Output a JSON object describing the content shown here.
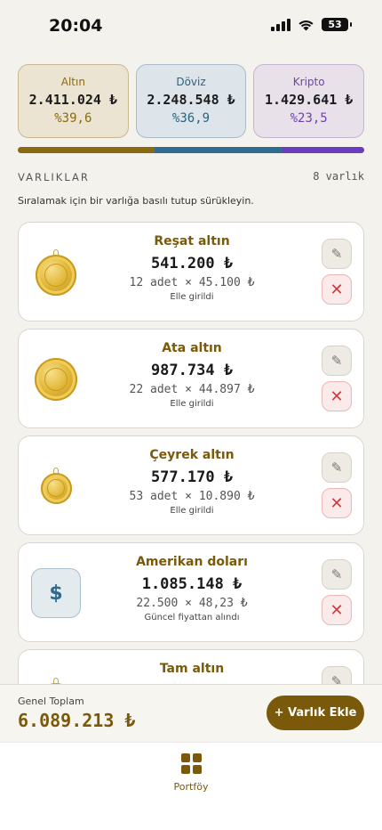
{
  "status": {
    "time": "20:04",
    "battery": "53"
  },
  "summary": [
    {
      "label": "Altın",
      "amount": "2.411.024 ₺",
      "percent": "%39,6"
    },
    {
      "label": "Döviz",
      "amount": "2.248.548 ₺",
      "percent": "%36,9"
    },
    {
      "label": "Kripto",
      "amount": "1.429.641 ₺",
      "percent": "%23,5"
    }
  ],
  "allocation": [
    {
      "name": "Altın",
      "share": 0.396,
      "color": "#8a6a10"
    },
    {
      "name": "Döviz",
      "share": 0.369,
      "color": "#2e6d8f"
    },
    {
      "name": "Kripto",
      "share": 0.235,
      "color": "#6a3cc0"
    }
  ],
  "section": {
    "title": "VARLIKLAR",
    "count": "8 varlık",
    "hint": "Sıralamak için bir varlığa basılı tutup sürükleyin."
  },
  "assets": [
    {
      "name": "Reşat altın",
      "value": "541.200 ₺",
      "qty": "12 adet × 45.100 ₺",
      "source": "Elle girildi",
      "icon": "resat-gold-coin-icon"
    },
    {
      "name": "Ata altın",
      "value": "987.734 ₺",
      "qty": "22 adet × 44.897 ₺",
      "source": "Elle girildi",
      "icon": "ata-gold-coin-icon"
    },
    {
      "name": "Çeyrek altın",
      "value": "577.170 ₺",
      "qty": "53 adet × 10.890 ₺",
      "source": "Elle girildi",
      "icon": "quarter-gold-coin-icon"
    },
    {
      "name": "Amerikan doları",
      "value": "1.085.148 ₺",
      "qty": "22.500 × 48,23 ₺",
      "source": "Güncel fiyattan alındı",
      "icon": "dollar-icon"
    },
    {
      "name": "Tam altın",
      "value": "",
      "qty": "",
      "source": "",
      "icon": "full-gold-coin-icon"
    }
  ],
  "icons": {
    "dollar_glyph": "$",
    "edit_glyph": "✎",
    "delete_glyph": "✕"
  },
  "footer": {
    "total_label": "Genel Toplam",
    "total_value": "6.089.213 ₺",
    "add_button": "+ Varlık Ekle"
  },
  "tabbar": {
    "tab_label": "Portföy"
  },
  "colors": {
    "accent": "#7a5a0a",
    "danger": "#d23b3b",
    "background": "#f4f2ed"
  }
}
